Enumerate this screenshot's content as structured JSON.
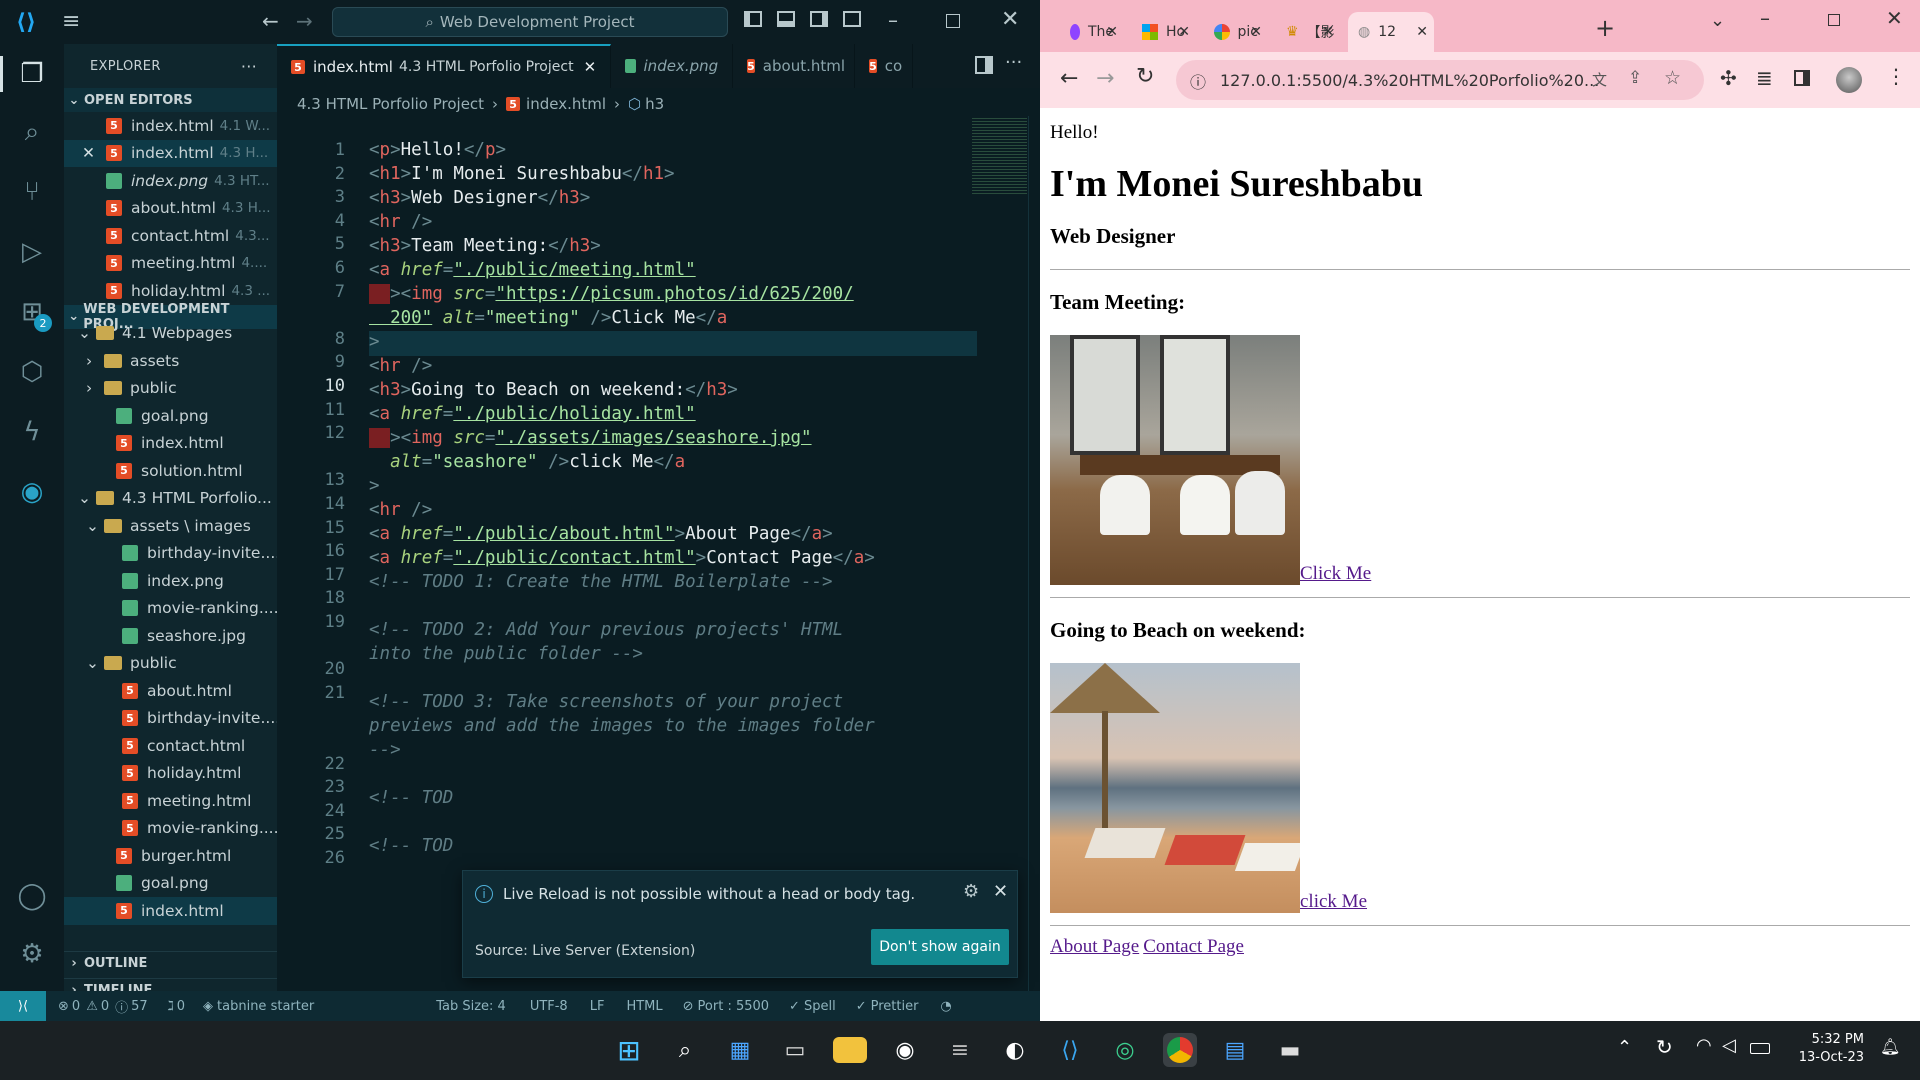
{
  "vscode": {
    "search_text": "Web Development Project",
    "explorer_title": "EXPLORER",
    "open_editors_title": "OPEN EDITORS",
    "open_editors": [
      {
        "name": "index.html",
        "dir": "4.1 W...",
        "type": "html"
      },
      {
        "name": "index.html",
        "dir": "4.3 H...",
        "type": "html"
      },
      {
        "name": "index.png",
        "dir": "4.3 HT...",
        "type": "image"
      },
      {
        "name": "about.html",
        "dir": "4.3 H...",
        "type": "html"
      },
      {
        "name": "contact.html",
        "dir": "4.3...",
        "type": "html"
      },
      {
        "name": "meeting.html",
        "dir": "4....",
        "type": "html"
      },
      {
        "name": "holiday.html",
        "dir": "4.3 ...",
        "type": "html"
      }
    ],
    "workspace_title": "WEB DEVELOPMENT PROJ...",
    "tree": [
      {
        "name": "4.1 Webpages",
        "type": "folder"
      },
      {
        "name": "assets",
        "type": "folder"
      },
      {
        "name": "public",
        "type": "folder"
      },
      {
        "name": "goal.png",
        "type": "image"
      },
      {
        "name": "index.html",
        "type": "html"
      },
      {
        "name": "solution.html",
        "type": "html"
      },
      {
        "name": "4.3 HTML Porfolio...",
        "type": "folder"
      },
      {
        "name": "assets \\ images",
        "type": "folder"
      },
      {
        "name": "birthday-invite....",
        "type": "image"
      },
      {
        "name": "index.png",
        "type": "image"
      },
      {
        "name": "movie-ranking....",
        "type": "image"
      },
      {
        "name": "seashore.jpg",
        "type": "image"
      },
      {
        "name": "public",
        "type": "folder"
      },
      {
        "name": "about.html",
        "type": "html"
      },
      {
        "name": "birthday-invite....",
        "type": "html"
      },
      {
        "name": "contact.html",
        "type": "html"
      },
      {
        "name": "holiday.html",
        "type": "html"
      },
      {
        "name": "meeting.html",
        "type": "html"
      },
      {
        "name": "movie-ranking....",
        "type": "html"
      },
      {
        "name": "burger.html",
        "type": "html"
      },
      {
        "name": "goal.png",
        "type": "image"
      },
      {
        "name": "index.html",
        "type": "html"
      }
    ],
    "outline_title": "OUTLINE",
    "timeline_title": "TIMELINE",
    "tabs": [
      {
        "name": "index.html",
        "desc": "4.3 HTML Porfolio Project",
        "type": "html"
      },
      {
        "name": "index.png",
        "desc": "",
        "type": "image"
      },
      {
        "name": "about.html",
        "desc": "",
        "type": "html"
      },
      {
        "name": "co",
        "desc": "",
        "type": "html"
      }
    ],
    "breadcrumb": [
      "4.3 HTML Porfolio Project",
      "index.html",
      "h3"
    ],
    "code_line_numbers": [
      "1",
      "2",
      "3",
      "4",
      "5",
      "6",
      "7",
      "",
      "8",
      "9",
      "10",
      "11",
      "12",
      "",
      "13",
      "14",
      "15",
      "16",
      "17",
      "18",
      "19",
      "",
      "20",
      "21",
      "",
      "",
      "22",
      "23",
      "24",
      "25",
      "26"
    ],
    "activity_badge": "2",
    "toast": {
      "message": "Live Reload is not possible without a head or body tag.",
      "source": "Source: Live Server (Extension)",
      "button": "Don't show again"
    },
    "status": {
      "errors": "0",
      "warnings": "0",
      "info": "57",
      "ports": "0",
      "tabnine": "tabnine starter",
      "tab_size": "Tab Size: 4",
      "encoding": "UTF-8",
      "eol": "LF",
      "language": "HTML",
      "port": "Port : 5500",
      "spell": "Spell",
      "prettier": "Prettier"
    }
  },
  "chrome": {
    "tabs": [
      "The",
      "Ho",
      "pic",
      "【影",
      "12"
    ],
    "url": "127.0.0.1:5500/4.3%20HTML%20Porfolio%20...",
    "page": {
      "hello": "Hello!",
      "h1": "I'm Monei Sureshbabu",
      "h3_designer": "Web Designer",
      "h3_meeting": "Team Meeting:",
      "link_click": "Click Me",
      "h3_beach": "Going to Beach on weekend:",
      "link_click2": "click Me",
      "link_about": "About Page",
      "link_contact": "Contact Page"
    }
  },
  "taskbar": {
    "time": "5:32 PM",
    "date": "13-Oct-23"
  }
}
